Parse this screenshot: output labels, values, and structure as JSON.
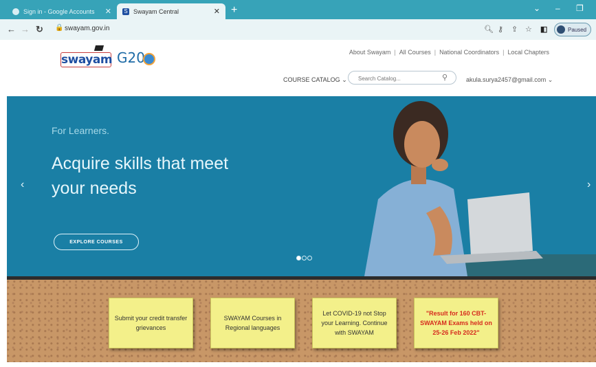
{
  "browser": {
    "tabs": [
      {
        "title": "Sign in - Google Accounts",
        "active": false
      },
      {
        "title": "Swayam Central",
        "active": true
      }
    ],
    "url": "swayam.gov.in",
    "profile_status": "Paused",
    "colors": {
      "tab_bar": "#37a3b8",
      "toolbar": "#eaf4f6"
    }
  },
  "header": {
    "logo_text": "swayam",
    "g20_text": "G20",
    "top_links": [
      "About Swayam",
      "All Courses",
      "National Coordinators",
      "Local Chapters"
    ],
    "catalog_label": "COURSE CATALOG",
    "search_placeholder": "Search Catalog...",
    "user_email": "akula.surya2457@gmail.com"
  },
  "hero": {
    "kicker": "For Learners.",
    "headline": "Acquire skills that meet your needs",
    "cta": "EXPLORE COURSES",
    "slides": 3,
    "active_slide": 1,
    "bg_color": "#1a7fa5"
  },
  "notice_board": {
    "notes": [
      {
        "text": "Submit your credit transfer grievances",
        "highlight": false
      },
      {
        "text": "SWAYAM Courses in Regional languages",
        "highlight": false
      },
      {
        "text": "Let COVID-19 not Stop your Learning. Continue with SWAYAM",
        "highlight": false
      },
      {
        "text": "\"Result for 160 CBT-SWAYAM Exams held on 25-26 Feb 2022\"",
        "highlight": true
      }
    ]
  }
}
